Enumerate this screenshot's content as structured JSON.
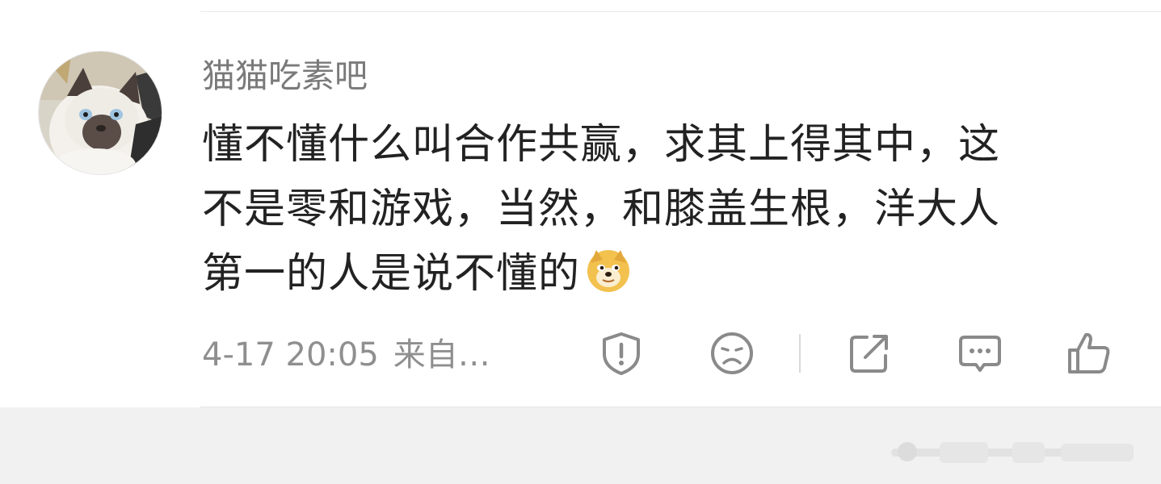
{
  "comment": {
    "username": "猫猫吃素吧",
    "content_lines": [
      "懂不懂什么叫合作共赢，求其上得其中，这",
      "不是零和游戏，当然，和膝盖生根，洋大人",
      "第一的人是说不懂的"
    ],
    "emoji": "doge-emoji",
    "timestamp": "4-17 20:05",
    "source": "来自…"
  },
  "actions": [
    {
      "name": "report-button",
      "icon": "shield-exclamation-icon"
    },
    {
      "name": "dislike-button",
      "icon": "sad-face-icon"
    },
    {
      "name": "share-button",
      "icon": "share-arrow-icon"
    },
    {
      "name": "reply-button",
      "icon": "chat-bubble-icon"
    },
    {
      "name": "like-button",
      "icon": "thumbs-up-icon"
    }
  ],
  "colors": {
    "text_primary": "#222222",
    "text_secondary": "#7a7a7a",
    "icon": "#8a8a8a",
    "background": "#ffffff",
    "footer_background": "#f1f1f1"
  }
}
